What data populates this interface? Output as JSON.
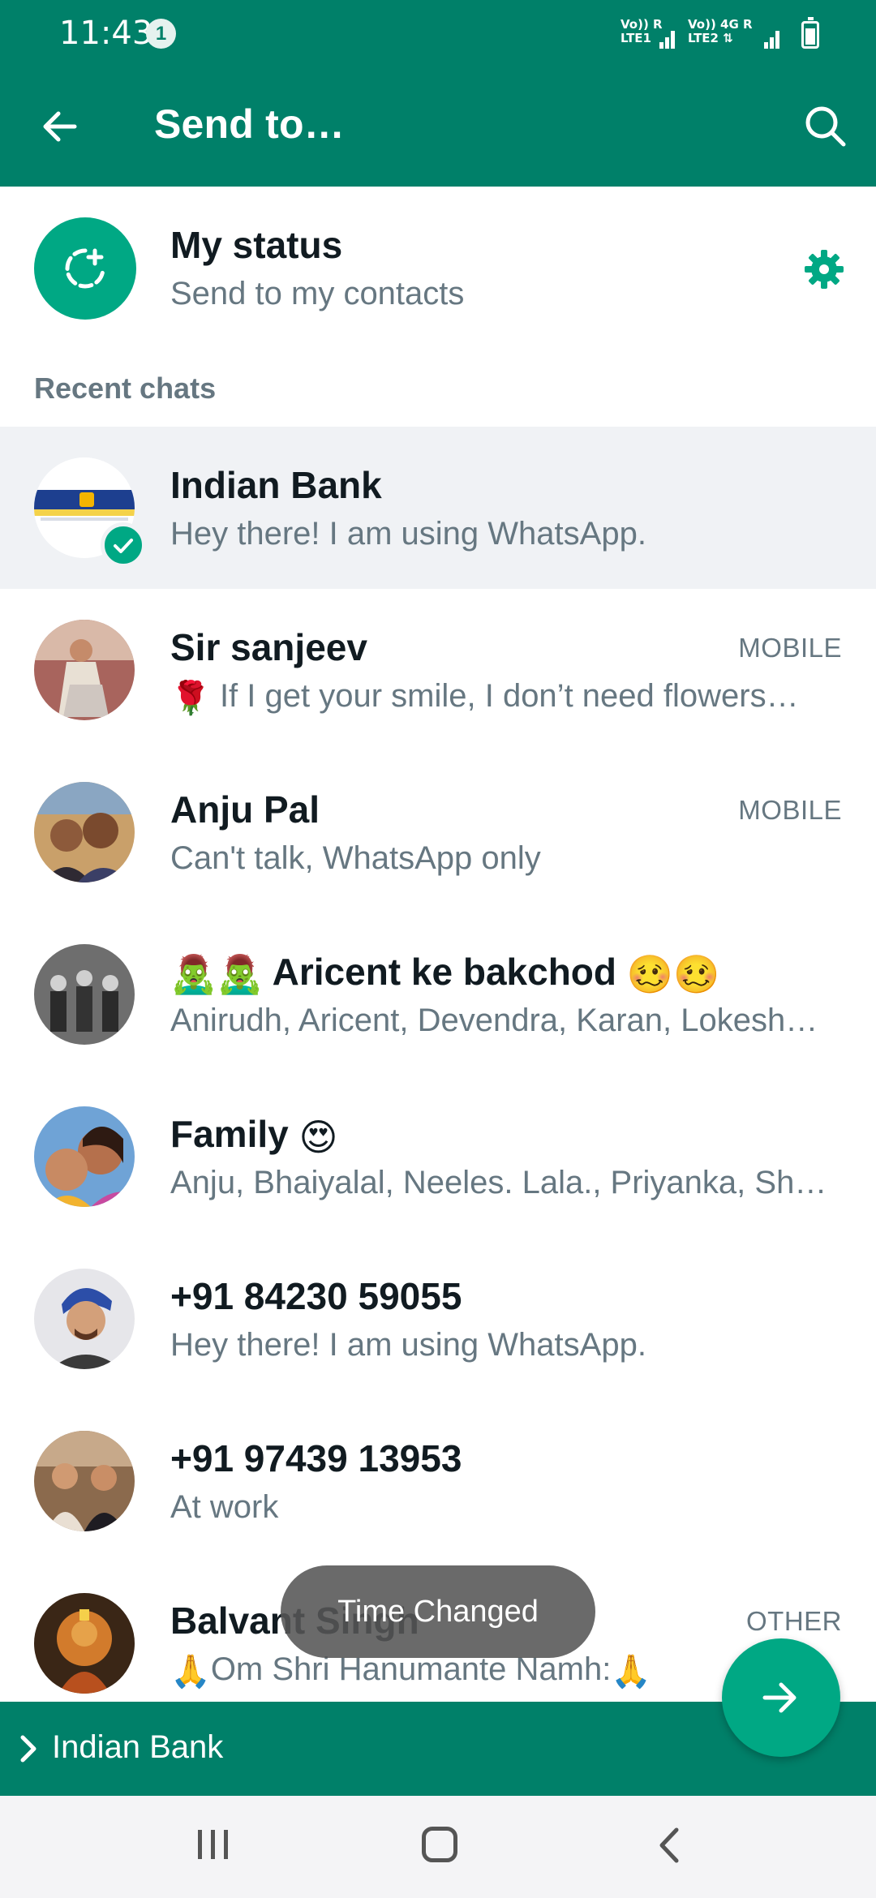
{
  "status_bar": {
    "time": "11:43",
    "notification_count": "1",
    "sim1_label": "Vo)) R\nLTE1",
    "sim2_label": "Vo)) 4G R\nLTE2"
  },
  "app_bar": {
    "title": "Send to…"
  },
  "my_status": {
    "title": "My status",
    "subtitle": "Send to my contacts"
  },
  "section_header": "Recent chats",
  "chats": [
    {
      "name": "Indian Bank",
      "subtitle": "Hey there! I am using WhatsApp.",
      "tag": "",
      "selected": true
    },
    {
      "name": "Sir sanjeev",
      "subtitle": "If I get your smile, I don’t need flowers…",
      "subtitle_emoji": "rose",
      "tag": "MOBILE",
      "selected": false
    },
    {
      "name": "Anju Pal",
      "subtitle": "Can't talk, WhatsApp only",
      "tag": "MOBILE",
      "selected": false
    },
    {
      "name": "Aricent ke bakchod",
      "subtitle": "Anirudh, Aricent, Devendra, Karan, Lokesh…",
      "tag": "",
      "selected": false
    },
    {
      "name": "Family",
      "subtitle": "Anju, Bhaiyalal, Neeles. Lala., Priyanka, Sh…",
      "tag": "",
      "selected": false
    },
    {
      "name": "+91 84230 59055",
      "subtitle": "Hey there! I am using WhatsApp.",
      "tag": "",
      "selected": false
    },
    {
      "name": "+91 97439 13953",
      "subtitle": "At work",
      "tag": "",
      "selected": false
    },
    {
      "name": "Balvant Singh",
      "subtitle": "Om Shri Hanumante Namh:",
      "tag": "OTHER",
      "selected": false
    }
  ],
  "toast": "Time Changed",
  "selection_bar": {
    "label": "Indian Bank"
  },
  "colors": {
    "brand": "#008069",
    "accent": "#00a884",
    "selected_row": "#f0f2f5"
  },
  "icons": [
    "back-arrow-icon",
    "search-icon",
    "status-add-icon",
    "gear-icon",
    "check-icon",
    "send-arrow-icon",
    "chevron-right-icon"
  ]
}
